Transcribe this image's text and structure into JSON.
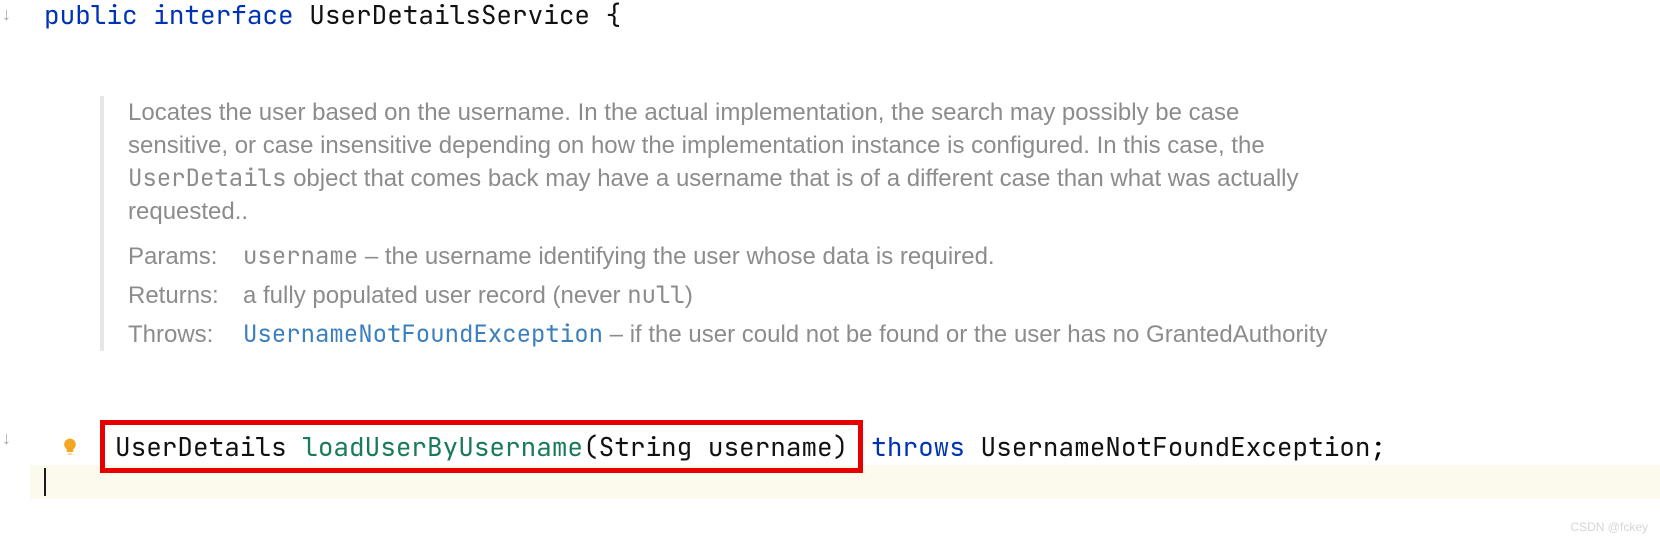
{
  "code": {
    "line1": {
      "kw_public": "public",
      "kw_interface": "interface",
      "type": "UserDetailsService",
      "brace": "{"
    },
    "method": {
      "return_type": "UserDetails",
      "name": "loadUserByUsername",
      "param_type": "String",
      "param_name": "username",
      "kw_throws": "throws",
      "exception": "UsernameNotFoundException",
      "semi": ";"
    }
  },
  "doc": {
    "desc_part1": "Locates the user based on the username. In the actual implementation, the search may possibly be case sensitive, or case insensitive depending on how the implementation instance is configured. In this case, the ",
    "desc_code": "UserDetails",
    "desc_part2": " object that comes back may have a username that is of a different case than what was actually requested..",
    "labels": {
      "params": "Params:",
      "returns": "Returns:",
      "throws": "Throws:"
    },
    "params": {
      "name": "username",
      "dash": " – ",
      "text": "the username identifying the user whose data is required."
    },
    "returns_text_part1": "a fully populated user record (never ",
    "returns_code": "null",
    "returns_text_part2": ")",
    "throws": {
      "link": "UsernameNotFoundException",
      "dash": " – ",
      "text": "if the user could not be found or the user has no GrantedAuthority"
    }
  },
  "watermark": "CSDN @fckey"
}
